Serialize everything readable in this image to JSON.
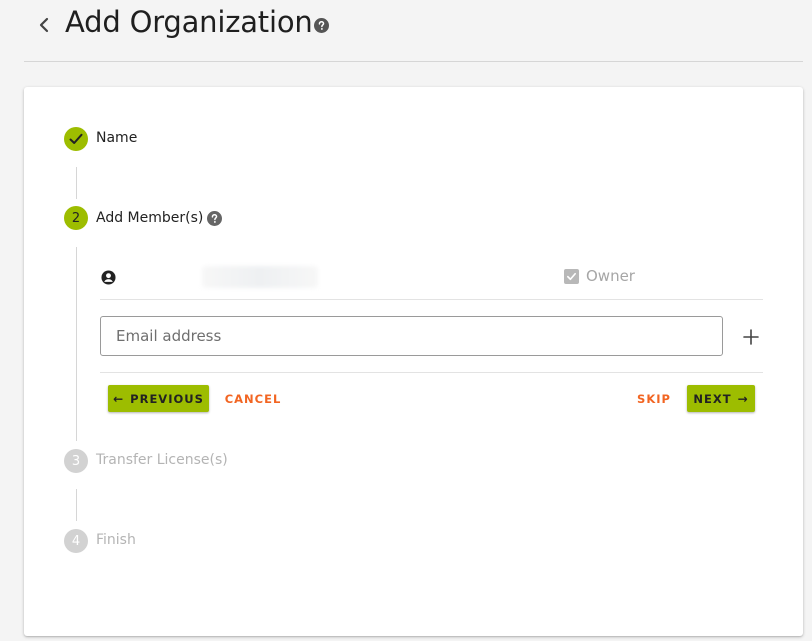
{
  "header": {
    "title": "Add Organization",
    "back_icon": "chevron-left-icon",
    "help_icon": "help-circle-icon"
  },
  "stepper": {
    "steps": [
      {
        "number": "",
        "label": "Name",
        "state": "completed"
      },
      {
        "number": "2",
        "label": "Add Member(s)",
        "state": "active"
      },
      {
        "number": "3",
        "label": "Transfer License(s)",
        "state": "pending"
      },
      {
        "number": "4",
        "label": "Finish",
        "state": "pending"
      }
    ]
  },
  "members": {
    "owner_label": "Owner",
    "owner_checked": true
  },
  "email_input": {
    "placeholder": "Email address",
    "value": ""
  },
  "actions": {
    "previous_label": "PREVIOUS",
    "cancel_label": "CANCEL",
    "skip_label": "SKIP",
    "next_label": "NEXT"
  },
  "colors": {
    "accent": "#9dbd00",
    "link_orange": "#f26522",
    "pending_gray": "#d2d2d2",
    "background": "#f4f4f4"
  }
}
